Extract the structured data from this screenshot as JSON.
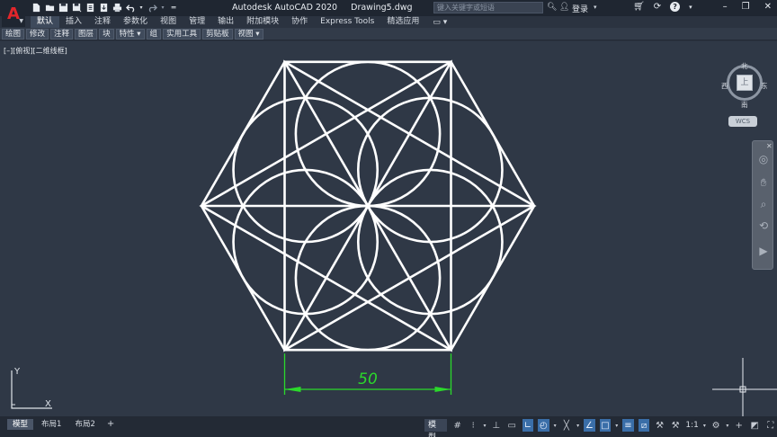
{
  "app": {
    "title": "Autodesk AutoCAD 2020",
    "filename": "Drawing5.dwg",
    "logo_letter": "A"
  },
  "search": {
    "placeholder": "键入关键字或短语"
  },
  "user": {
    "login_label": "登录"
  },
  "ribbon": {
    "tabs": [
      {
        "label": "默认",
        "active": true
      },
      {
        "label": "插入"
      },
      {
        "label": "注释"
      },
      {
        "label": "参数化"
      },
      {
        "label": "视图"
      },
      {
        "label": "管理"
      },
      {
        "label": "输出"
      },
      {
        "label": "附加模块"
      },
      {
        "label": "协作"
      },
      {
        "label": "Express Tools"
      },
      {
        "label": "精选应用"
      }
    ],
    "panels": [
      "绘图",
      "修改",
      "注释",
      "图层",
      "块",
      "特性 ▾",
      "组",
      "实用工具",
      "剪贴板",
      "视图 ▾"
    ]
  },
  "viewport": {
    "label": "[–][俯视][二维线框]",
    "dimension_text": "50",
    "colors": {
      "background": "#2f3846",
      "geometry": "#ffffff",
      "dimension": "#2bd92b"
    }
  },
  "viewcube": {
    "north": "北",
    "south": "南",
    "east": "东",
    "west": "西",
    "face": "上",
    "wcs": "WCS"
  },
  "ucs": {
    "x_label": "X",
    "y_label": "Y"
  },
  "layout_tabs": [
    {
      "label": "模型",
      "active": true
    },
    {
      "label": "布局1"
    },
    {
      "label": "布局2"
    }
  ],
  "status": {
    "model_label": "模型",
    "scale_label": "1:1"
  },
  "icons": {
    "qat": [
      "new-icon",
      "open-icon",
      "save-icon",
      "save-as-icon",
      "open-web-icon",
      "save-web-icon",
      "plot-icon",
      "undo-icon",
      "redo-icon",
      "customize-icon"
    ],
    "navbar": [
      "steering-wheel-icon",
      "pan-icon",
      "zoom-icon",
      "orbit-icon",
      "showmotion-icon"
    ]
  }
}
